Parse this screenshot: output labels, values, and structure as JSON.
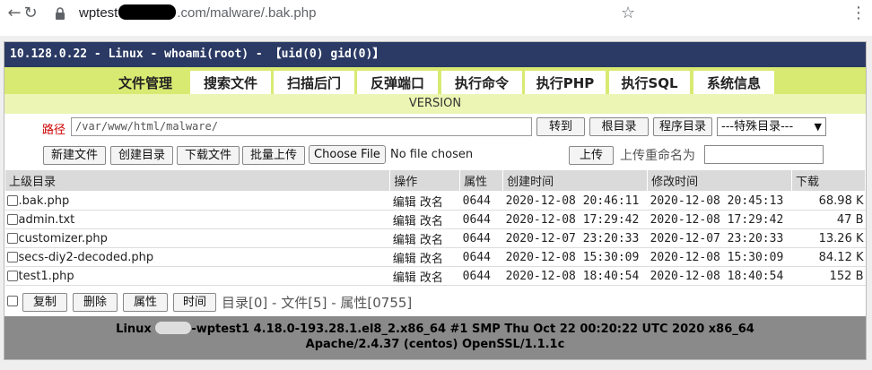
{
  "browser": {
    "url_prefix": "wptest",
    "url_suffix": ".com/malware/.bak.php"
  },
  "header": {
    "title": "10.128.0.22 - Linux - whoami(root) - 【uid(0) gid(0)】"
  },
  "tabs": [
    {
      "label": "文件管理"
    },
    {
      "label": "搜索文件"
    },
    {
      "label": "扫描后门"
    },
    {
      "label": "反弹端口"
    },
    {
      "label": "执行命令"
    },
    {
      "label": "执行PHP"
    },
    {
      "label": "执行SQL"
    },
    {
      "label": "系统信息"
    }
  ],
  "version": "VERSION",
  "toolbar": {
    "path_label": "路径",
    "path_value": "/var/www/html/malware/",
    "goto": "转到",
    "root_dir": "根目录",
    "program_dir": "程序目录",
    "special_dir": "---特殊目录---",
    "new_file": "新建文件",
    "create_dir": "创建目录",
    "download_file": "下载文件",
    "batch_upload": "批量上传",
    "choose_file": "Choose File",
    "no_file": "No file chosen",
    "upload": "上传",
    "rename_label": "上传重命名为"
  },
  "table": {
    "headers": [
      "上级目录",
      "操作",
      "属性",
      "创建时间",
      "修改时间",
      "下载"
    ],
    "rows": [
      {
        "name": ".bak.php",
        "ops": "编辑 改名",
        "perm": "0644",
        "created": "2020-12-08 20:46:11",
        "modified": "2020-12-08 20:45:13",
        "size": "68.98 K"
      },
      {
        "name": "admin.txt",
        "ops": "编辑 改名",
        "perm": "0644",
        "created": "2020-12-08 17:29:42",
        "modified": "2020-12-08 17:29:42",
        "size": "47 B"
      },
      {
        "name": "customizer.php",
        "ops": "编辑 改名",
        "perm": "0644",
        "created": "2020-12-07 23:20:33",
        "modified": "2020-12-07 23:20:33",
        "size": "13.26 K"
      },
      {
        "name": "secs-diy2-decoded.php",
        "ops": "编辑 改名",
        "perm": "0644",
        "created": "2020-12-08 15:30:09",
        "modified": "2020-12-08 15:30:09",
        "size": "84.12 K"
      },
      {
        "name": "test1.php",
        "ops": "编辑 改名",
        "perm": "0644",
        "created": "2020-12-08 18:40:54",
        "modified": "2020-12-08 18:40:54",
        "size": "152 B"
      }
    ]
  },
  "footer": {
    "copy": "复制",
    "delete": "删除",
    "attr": "属性",
    "time": "时间",
    "summary": "目录[0] - 文件[5] - 属性[0755]"
  },
  "sysinfo": {
    "line1_prefix": "Linux",
    "line1_suffix": "-wptest1 4.18.0-193.28.1.el8_2.x86_64 #1 SMP Thu Oct 22 00:20:22 UTC 2020 x86_64",
    "line2": "Apache/2.4.37 (centos) OpenSSL/1.1.1c"
  }
}
